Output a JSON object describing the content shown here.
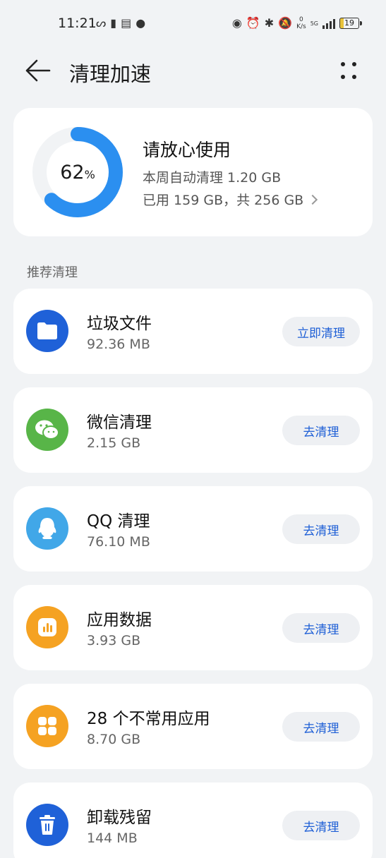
{
  "status_bar": {
    "time": "11:21",
    "net_speed_value": "0",
    "net_speed_unit": "K/s",
    "net_type": "5G",
    "battery": "19"
  },
  "header": {
    "title": "清理加速"
  },
  "summary": {
    "percent_value": "62",
    "percent_sign": "%",
    "percent": 0.62,
    "status": "请放心使用",
    "weekly_clean": "本周自动清理 1.20 GB",
    "storage": "已用 159 GB，共 256 GB",
    "ring_color": "#2b8ff0"
  },
  "section": {
    "label": "推荐清理"
  },
  "items": [
    {
      "title": "垃圾文件",
      "size": "92.36 MB",
      "button": "立即清理",
      "icon": "folder-icon",
      "color": "#1f61d8"
    },
    {
      "title": "微信清理",
      "size": "2.15 GB",
      "button": "去清理",
      "icon": "wechat-icon",
      "color": "#58b548"
    },
    {
      "title": "QQ 清理",
      "size": "76.10 MB",
      "button": "去清理",
      "icon": "qq-icon",
      "color": "#41a7e8"
    },
    {
      "title": "应用数据",
      "size": "3.93 GB",
      "button": "去清理",
      "icon": "app-data-icon",
      "color": "#f5a222"
    },
    {
      "title": "28 个不常用应用",
      "size": "8.70 GB",
      "button": "去清理",
      "icon": "apps-grid-icon",
      "color": "#f5a222"
    },
    {
      "title": "卸载残留",
      "size": "144 MB",
      "button": "去清理",
      "icon": "trash-icon",
      "color": "#1f61d8"
    }
  ]
}
